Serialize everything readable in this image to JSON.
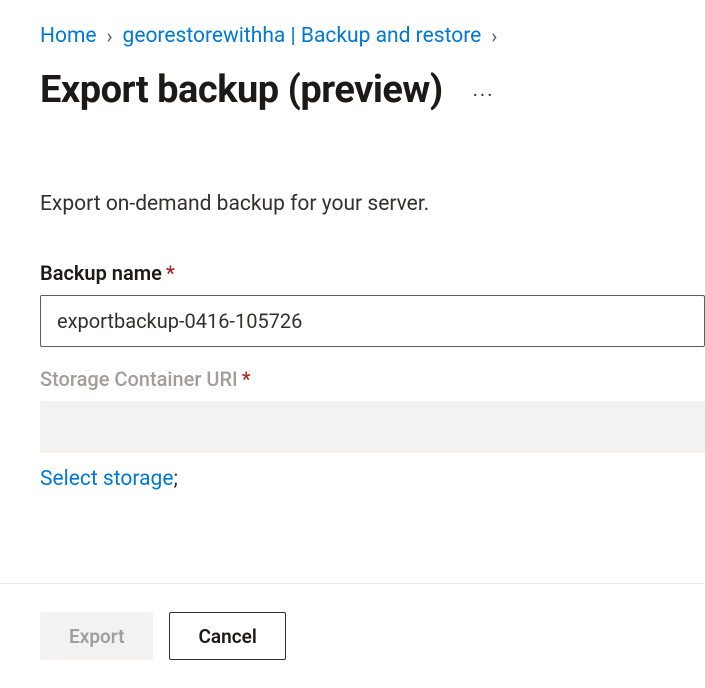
{
  "breadcrumb": {
    "home": "Home",
    "item1": "georestorewithha | Backup and restore"
  },
  "page": {
    "title": "Export backup (preview)",
    "description": "Export on-demand backup for your server."
  },
  "form": {
    "backup_name_label": "Backup name",
    "backup_name_value": "exportbackup-0416-105726",
    "storage_uri_label": "Storage Container URI",
    "storage_uri_value": "",
    "select_storage_link": "Select storage",
    "semicolon": ";"
  },
  "footer": {
    "export_label": "Export",
    "cancel_label": "Cancel"
  }
}
